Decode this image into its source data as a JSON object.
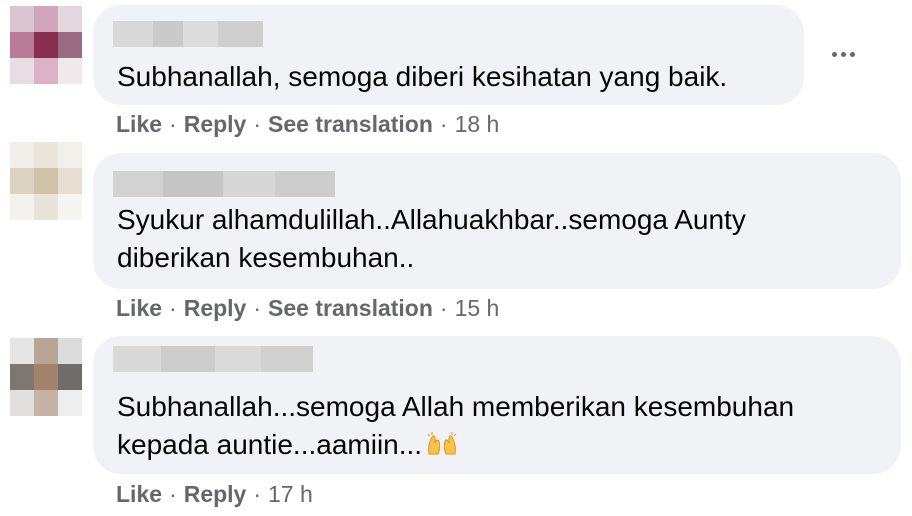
{
  "comments": [
    {
      "text": "Subhanallah, semoga diberi kesihatan yang baik.",
      "like": "Like",
      "reply": "Reply",
      "translate": "See translation",
      "time": "18 h",
      "sep": "·"
    },
    {
      "text": "Syukur alhamdulillah..Allahuakhbar..semoga Aunty\ndiberikan kesembuhan..",
      "like": "Like",
      "reply": "Reply",
      "translate": "See translation",
      "time": "15 h",
      "sep": "·"
    },
    {
      "text": "Subhanallah...semoga Allah memberikan kesembuhan\nkepada auntie...aamiin...",
      "like": "Like",
      "reply": "Reply",
      "time": "17 h",
      "sep": "·",
      "emoji": "raising-hands-emoji"
    }
  ],
  "icons": {
    "more": "more-options-icon"
  },
  "colors": {
    "bubble": "#f0f2f5",
    "meta": "#65676b",
    "text": "#050505"
  }
}
